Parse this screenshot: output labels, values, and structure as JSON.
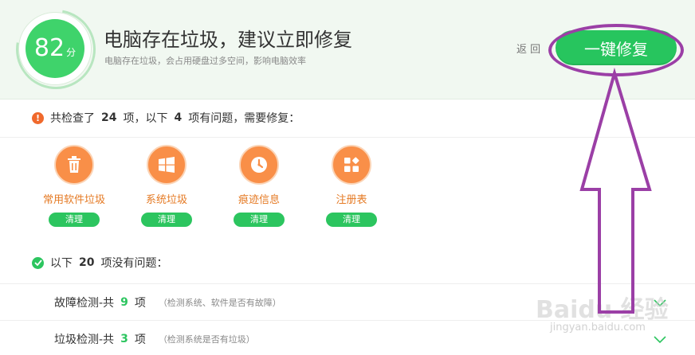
{
  "header": {
    "score": "82",
    "score_unit": "分",
    "title": "电脑存在垃圾，建议立即修复",
    "subtitle": "电脑存在垃圾，会占用硬盘过多空间，影响电脑效率",
    "back_label": "返 回",
    "fix_button_label": "一键修复"
  },
  "summary": {
    "part1": "共检查了",
    "total": "24",
    "part2": "项，以下",
    "problems": "4",
    "part3": "项有问题，需要修复："
  },
  "issues": [
    {
      "label": "常用软件垃圾",
      "button": "清理",
      "icon": "trash-icon"
    },
    {
      "label": "系统垃圾",
      "button": "清理",
      "icon": "windows-icon"
    },
    {
      "label": "痕迹信息",
      "button": "清理",
      "icon": "history-icon"
    },
    {
      "label": "注册表",
      "button": "清理",
      "icon": "registry-icon"
    }
  ],
  "ok": {
    "part1": "以下",
    "count": "20",
    "part2": "项没有问题："
  },
  "details": [
    {
      "title": "故障检测-共",
      "count": "9",
      "unit": "项",
      "note": "（检测系统、软件是否有故障）"
    },
    {
      "title": "垃圾检测-共",
      "count": "3",
      "unit": "项",
      "note": "（检测系统是否有垃圾）"
    }
  ],
  "watermark": {
    "brand": "Baidu 经验",
    "url": "jingyan.baidu.com"
  },
  "colors": {
    "accent_green": "#27c55e",
    "warning_orange": "#f0692c",
    "issue_orange": "#f98f48",
    "annotation_purple": "#9b3fa6"
  }
}
